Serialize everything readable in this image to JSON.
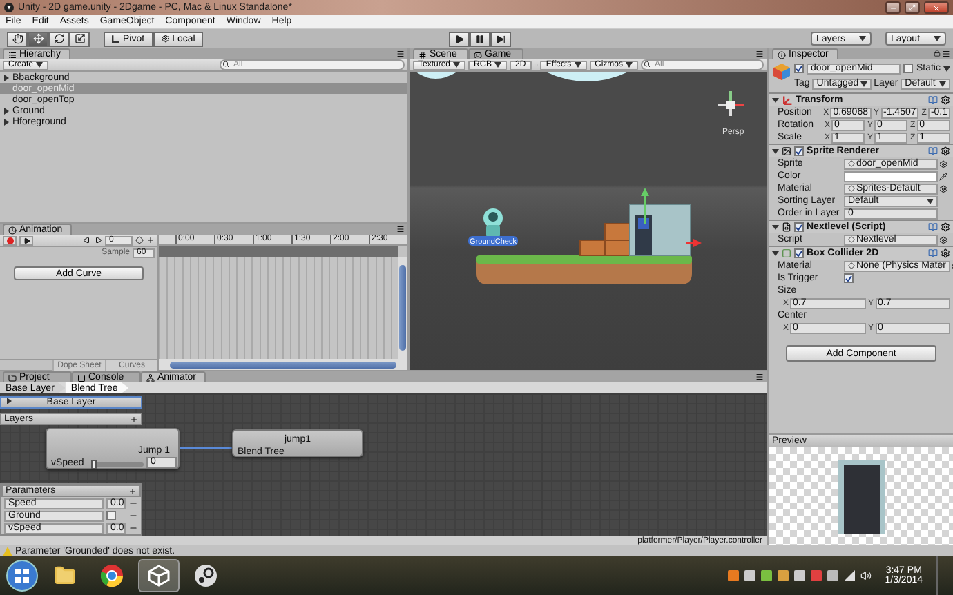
{
  "window": {
    "title": "Unity - 2D game.unity - 2Dgame - PC, Mac & Linux Standalone*"
  },
  "menu": [
    "File",
    "Edit",
    "Assets",
    "GameObject",
    "Component",
    "Window",
    "Help"
  ],
  "toolbar": {
    "tools": [
      {
        "kind": "hand",
        "selected": false
      },
      {
        "kind": "move",
        "selected": true
      },
      {
        "kind": "rotate",
        "selected": false
      },
      {
        "kind": "scale",
        "selected": false
      }
    ],
    "pivot": "Pivot",
    "local": "Local",
    "layers": "Layers",
    "layout": "Layout"
  },
  "hierarchy": {
    "title": "Hierarchy",
    "create": "Create",
    "search_placeholder": "All",
    "items": [
      {
        "label": "Bbackground",
        "expandable": true,
        "selected": false
      },
      {
        "label": "door_openMid",
        "expandable": false,
        "selected": true
      },
      {
        "label": "door_openTop",
        "expandable": false,
        "selected": false
      },
      {
        "label": "Ground",
        "expandable": true,
        "selected": false
      },
      {
        "label": "Hforeground",
        "expandable": true,
        "selected": false
      }
    ]
  },
  "scene": {
    "tabs": [
      {
        "label": "Scene",
        "kind": "scene",
        "selected": true
      },
      {
        "label": "Game",
        "kind": "game",
        "selected": false
      }
    ],
    "shading": "Textured",
    "render_mode": "RGB",
    "mode_2d": "2D",
    "effects": "Effects",
    "gizmos": "Gizmos",
    "search_placeholder": "All",
    "projection": "Persp",
    "object_label": "GroundCheck"
  },
  "animation": {
    "title": "Animation",
    "frame": "0",
    "sample_label": "Sample",
    "sample": "60",
    "add_curve": "Add Curve",
    "ticks": [
      "0:00",
      "0:30",
      "1:00",
      "1:30",
      "2:00",
      "2:30"
    ],
    "views": [
      {
        "label": "Dope Sheet",
        "selected": false
      },
      {
        "label": "Curves",
        "selected": false
      }
    ]
  },
  "inspector": {
    "title": "Inspector",
    "object": {
      "active": true,
      "name": "door_openMid",
      "static_label": "Static",
      "static": false,
      "tag_label": "Tag",
      "tag": "Untagged",
      "layer_label": "Layer",
      "layer": "Default"
    },
    "components": [
      {
        "kind": "transform",
        "title": "Transform",
        "expanded": true,
        "rows": [
          {
            "label": "Position",
            "values": [
              {
                "axis": "X",
                "value": "0.69068"
              },
              {
                "axis": "Y",
                "value": "-1.4507"
              },
              {
                "axis": "Z",
                "value": "-0.1"
              }
            ]
          },
          {
            "label": "Rotation",
            "values": [
              {
                "axis": "X",
                "value": "0"
              },
              {
                "axis": "Y",
                "value": "0"
              },
              {
                "axis": "Z",
                "value": "0"
              }
            ]
          },
          {
            "label": "Scale",
            "values": [
              {
                "axis": "X",
                "value": "1"
              },
              {
                "axis": "Y",
                "value": "1"
              },
              {
                "axis": "Z",
                "value": "1"
              }
            ]
          }
        ]
      },
      {
        "kind": "sprite_renderer",
        "title": "Sprite Renderer",
        "expanded": true,
        "enabled": true,
        "fields": [
          {
            "kind": "object",
            "label": "Sprite",
            "value": "door_openMid"
          },
          {
            "kind": "color",
            "label": "Color"
          },
          {
            "kind": "object",
            "label": "Material",
            "value": "Sprites-Default"
          },
          {
            "kind": "dropdown",
            "label": "Sorting Layer",
            "value": "Default"
          },
          {
            "kind": "number",
            "label": "Order in Layer",
            "value": "0"
          }
        ]
      },
      {
        "kind": "script",
        "title": "Nextlevel (Script)",
        "expanded": true,
        "enabled": true,
        "fields": [
          {
            "kind": "object",
            "label": "Script",
            "value": "Nextlevel"
          }
        ]
      },
      {
        "kind": "collider",
        "title": "Box Collider 2D",
        "expanded": true,
        "enabled": true,
        "fields": [
          {
            "kind": "object",
            "label": "Material",
            "value": "None (Physics Mater"
          },
          {
            "kind": "checkbox",
            "label": "Is Trigger",
            "checked": true
          },
          {
            "kind": "vector2",
            "label": "Size",
            "values": [
              {
                "axis": "X",
                "value": "0.7"
              },
              {
                "axis": "Y",
                "value": "0.7"
              }
            ]
          },
          {
            "kind": "vector2",
            "label": "Center",
            "values": [
              {
                "axis": "X",
                "value": "0"
              },
              {
                "axis": "Y",
                "value": "0"
              }
            ]
          }
        ]
      }
    ],
    "add_component": "Add Component"
  },
  "preview": {
    "title": "Preview"
  },
  "bottom_tabs": [
    {
      "label": "Project",
      "kind": "project",
      "selected": false
    },
    {
      "label": "Console",
      "kind": "console",
      "selected": false
    },
    {
      "label": "Animator",
      "kind": "animator",
      "selected": true
    }
  ],
  "animator": {
    "breadcrumb": [
      {
        "label": "Base Layer",
        "selected": false
      },
      {
        "label": "Blend Tree",
        "selected": true
      }
    ],
    "layer": "Base Layer",
    "layers_title": "Layers",
    "blend_node": {
      "output": "Jump 1",
      "parameter": "vSpeed",
      "value": "0",
      "level": 0
    },
    "state_node": {
      "title": "jump1",
      "input": "Blend Tree"
    },
    "parameters": {
      "title": "Parameters",
      "items": [
        {
          "name": "Speed",
          "kind": "float",
          "value": "0.0"
        },
        {
          "name": "Ground",
          "kind": "bool",
          "checked": false
        },
        {
          "name": "vSpeed",
          "kind": "float",
          "value": "0.0"
        }
      ]
    },
    "path": "platformer/Player/Player.controller"
  },
  "status_bar": {
    "message": "Parameter 'Grounded' does not exist."
  },
  "taskbar": {
    "time": "3:47 PM",
    "date": "1/3/2014"
  }
}
